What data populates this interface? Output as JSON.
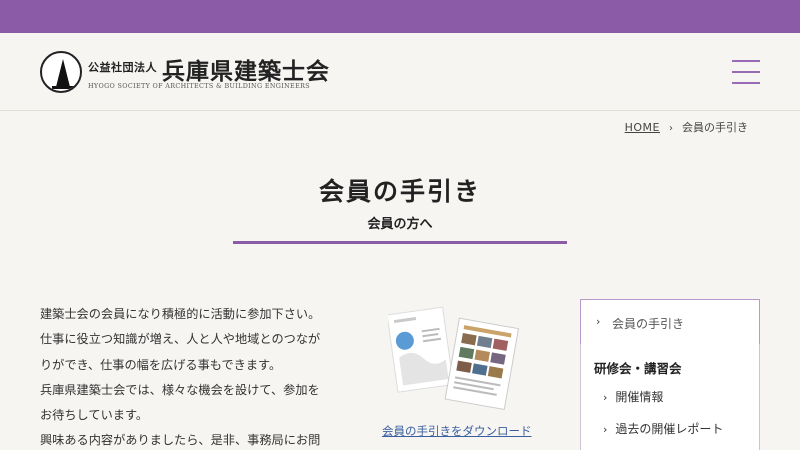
{
  "colors": {
    "brand": "#8b5ba8",
    "link": "#3a5fa0",
    "background": "#f7f5f2"
  },
  "header": {
    "logo_small": "公益社団法人",
    "logo_name": "兵庫県建築士会",
    "logo_english": "HYOGO SOCIETY OF ARCHITECTS & BUILDING ENGINEERS",
    "menu_icon": "hamburger-icon"
  },
  "breadcrumb": {
    "home": "HOME",
    "separator": "›",
    "current": "会員の手引き"
  },
  "page": {
    "title": "会員の手引き",
    "subtitle": "会員の方へ"
  },
  "intro_lines": [
    "建築士会の会員になり積極的に活動に参加下さい。",
    "仕事に役立つ知識が増え、人と人や地域とのつなが",
    "りができ、仕事の幅を広げる事もできます。",
    "兵庫県建築士会では、様々な機会を設けて、参加を",
    "お待ちしています。",
    "興味ある内容がありましたら、是非、事務局にお問"
  ],
  "download": {
    "link_text": "会員の手引きをダウンロード"
  },
  "sidebar": {
    "current": "会員の手引き",
    "group": "研修会・講習会",
    "items": [
      "開催情報",
      "過去の開催レポート"
    ],
    "chevron": "›"
  }
}
